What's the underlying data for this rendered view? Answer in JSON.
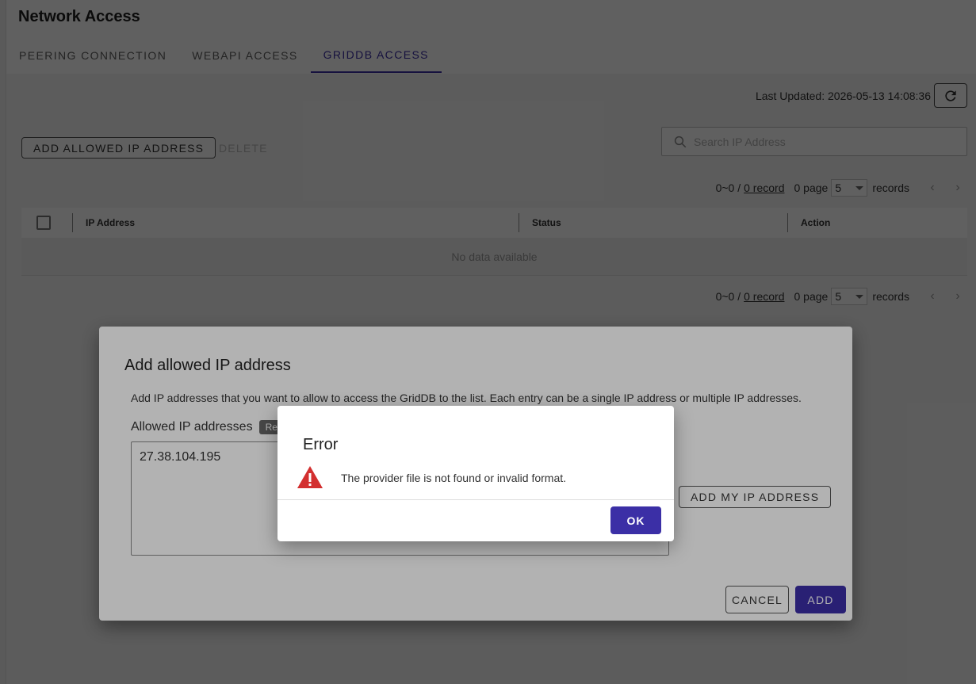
{
  "page": {
    "title": "Network Access",
    "tabs": [
      {
        "label": "PEERING CONNECTION",
        "active": false
      },
      {
        "label": "WEBAPI ACCESS",
        "active": false
      },
      {
        "label": "GRIDDB ACCESS",
        "active": true
      }
    ]
  },
  "toolbar": {
    "last_updated": "Last Updated: 2026-05-13 14:08:36",
    "refresh_icon": "refresh-icon",
    "add_allowed_ip_label": "ADD ALLOWED IP ADDRESS",
    "delete_label": "DELETE",
    "search_placeholder": "Search IP Address",
    "search_icon": "search-icon"
  },
  "pager": {
    "range": "0~0 /",
    "record_link": "0 record",
    "page_label": "0 page",
    "per_page": "5",
    "records_label": "records"
  },
  "table": {
    "columns": [
      "IP Address",
      "Status",
      "Action"
    ],
    "empty_text": "No data available"
  },
  "add_dialog": {
    "title": "Add allowed IP address",
    "description": "Add IP addresses that you want to allow to access the GridDB to the list. Each entry can be a single IP address or multiple IP addresses.",
    "field_label": "Allowed IP addresses",
    "required_badge": "Re",
    "ip_value": "27.38.104.195",
    "add_my_ip_label": "ADD MY IP ADDRESS",
    "cancel_label": "CANCEL",
    "add_label": "ADD"
  },
  "error_dialog": {
    "title": "Error",
    "icon": "warning-icon",
    "message": "The provider file is not found or invalid format.",
    "ok_label": "OK"
  },
  "colors": {
    "primary": "#3b2fa6",
    "warning": "#d32f2f"
  }
}
